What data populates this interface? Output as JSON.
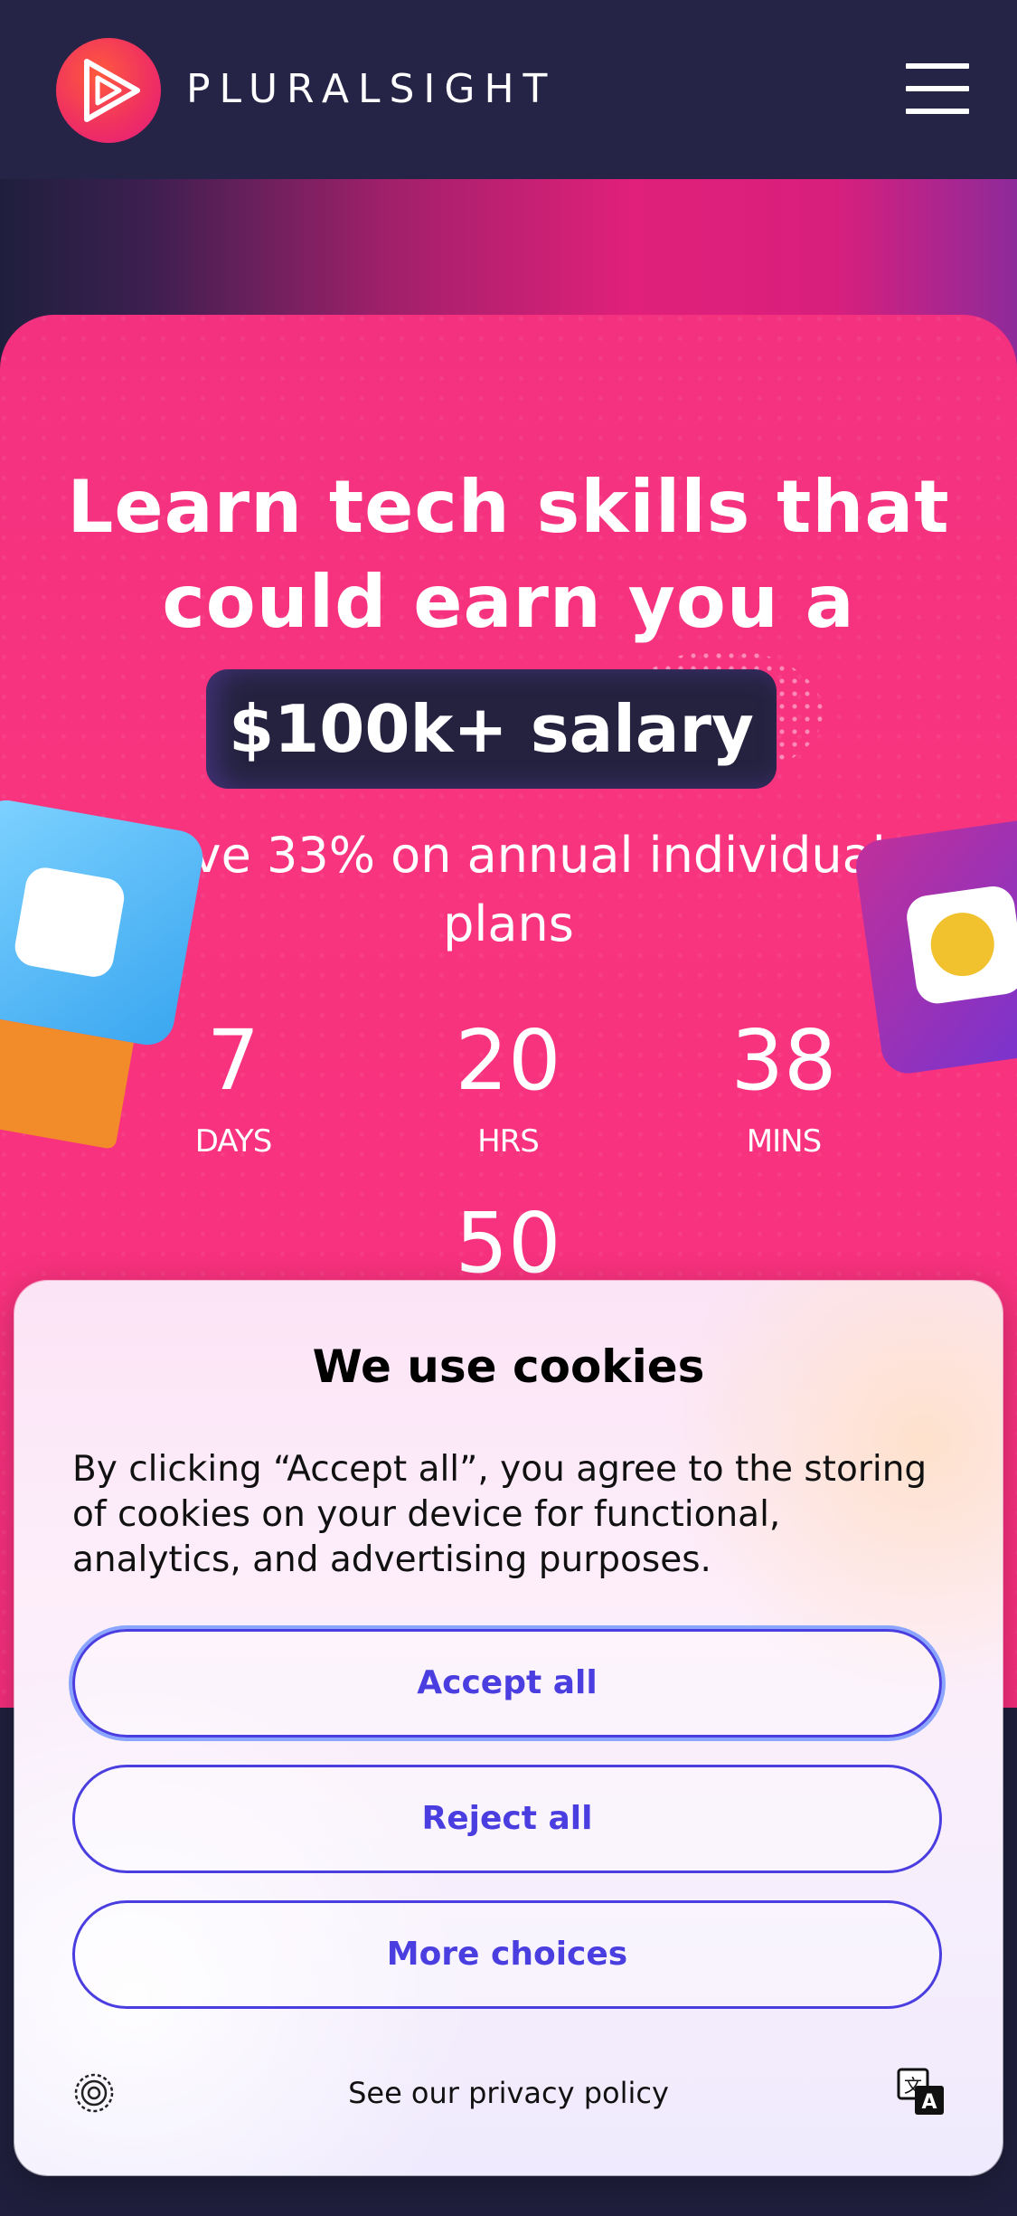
{
  "header": {
    "brand_name": "PLURALSIGHT",
    "menu_icon": "hamburger-menu-icon"
  },
  "hero": {
    "title_line1": "Learn tech skills that",
    "title_line2": "could earn you a",
    "salary_badge": "$100k+ salary",
    "subtitle": "Save 33% on annual individual plans",
    "countdown": {
      "days_value": "7",
      "days_label": "DAYS",
      "hours_value": "20",
      "hours_label": "HRS",
      "mins_value": "38",
      "mins_label": "MINS",
      "secs_value": "50"
    }
  },
  "cookie_dialog": {
    "title": "We use cookies",
    "body": "By clicking “Accept all”, you agree to the storing of cookies on your device for functional, analytics, and advertising purposes.",
    "accept_label": "Accept all",
    "reject_label": "Reject all",
    "more_label": "More choices",
    "privacy_link": "See our privacy policy",
    "privacy_icon": "privacy-fingerprint-icon",
    "translate_icon": "translate-icon"
  },
  "colors": {
    "header_bg": "#252446",
    "hero_pink": "#f9347f",
    "badge_bg": "#24223f",
    "button_accent": "#4a3ee0"
  }
}
